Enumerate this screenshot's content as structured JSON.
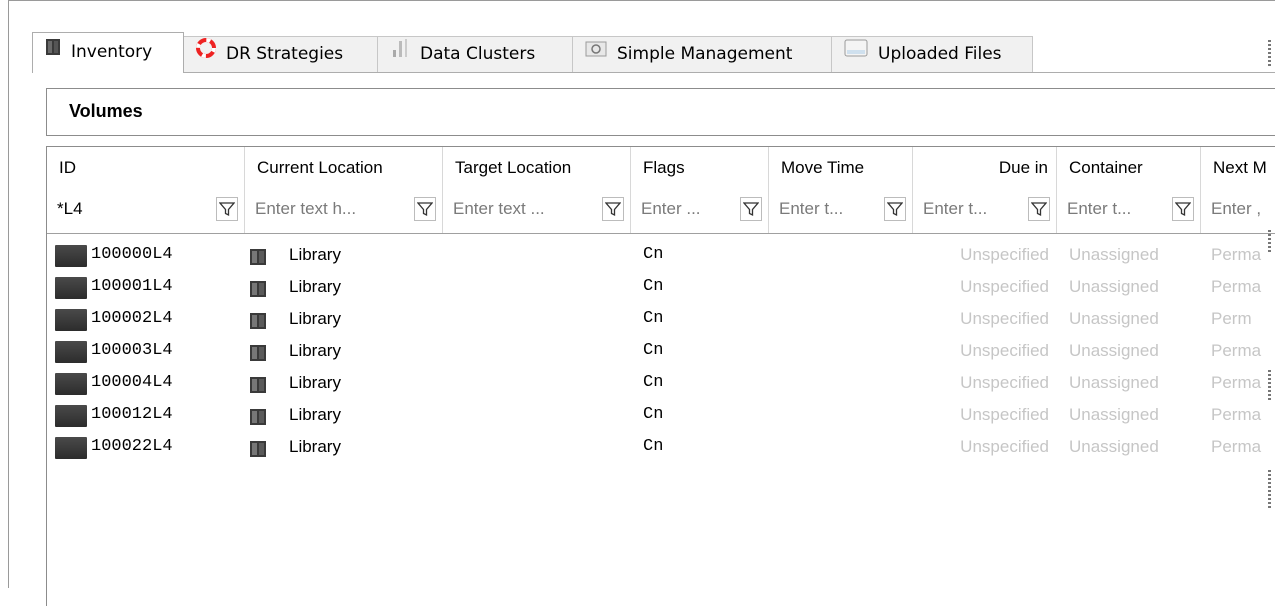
{
  "tabs": [
    {
      "label": "Inventory",
      "icon": "tape-library-icon",
      "active": true
    },
    {
      "label": "DR Strategies",
      "icon": "lifebuoy-icon",
      "active": false
    },
    {
      "label": "Data Clusters",
      "icon": "data-clusters-icon",
      "active": false
    },
    {
      "label": "Simple Management",
      "icon": "simple-management-icon",
      "active": false
    },
    {
      "label": "Uploaded Files",
      "icon": "uploaded-files-icon",
      "active": false
    }
  ],
  "panel": {
    "title": "Volumes"
  },
  "columns": [
    {
      "header": "ID",
      "filter_value": "*L4",
      "filter_placeholder": ""
    },
    {
      "header": "Current Location",
      "filter_value": "",
      "filter_placeholder": "Enter text h..."
    },
    {
      "header": "Target Location",
      "filter_value": "",
      "filter_placeholder": "Enter text ..."
    },
    {
      "header": "Flags",
      "filter_value": "",
      "filter_placeholder": "Enter ..."
    },
    {
      "header": "Move Time",
      "filter_value": "",
      "filter_placeholder": "Enter t..."
    },
    {
      "header": "Due in",
      "filter_value": "",
      "filter_placeholder": "Enter t..."
    },
    {
      "header": "Container",
      "filter_value": "",
      "filter_placeholder": "Enter t..."
    },
    {
      "header": "Next M",
      "filter_value": "",
      "filter_placeholder": "Enter ,"
    }
  ],
  "rows": [
    {
      "id": "100000L4",
      "current_location": "Library",
      "flags": "Cn",
      "due_in": "Unspecified",
      "container": "Unassigned",
      "next": "Perma"
    },
    {
      "id": "100001L4",
      "current_location": "Library",
      "flags": "Cn",
      "due_in": "Unspecified",
      "container": "Unassigned",
      "next": "Perma"
    },
    {
      "id": "100002L4",
      "current_location": "Library",
      "flags": "Cn",
      "due_in": "Unspecified",
      "container": "Unassigned",
      "next": "Perm"
    },
    {
      "id": "100003L4",
      "current_location": "Library",
      "flags": "Cn",
      "due_in": "Unspecified",
      "container": "Unassigned",
      "next": "Perma"
    },
    {
      "id": "100004L4",
      "current_location": "Library",
      "flags": "Cn",
      "due_in": "Unspecified",
      "container": "Unassigned",
      "next": "Perma"
    },
    {
      "id": "100012L4",
      "current_location": "Library",
      "flags": "Cn",
      "due_in": "Unspecified",
      "container": "Unassigned",
      "next": "Perma"
    },
    {
      "id": "100022L4",
      "current_location": "Library",
      "flags": "Cn",
      "due_in": "Unspecified",
      "container": "Unassigned",
      "next": "Perma"
    }
  ],
  "colors": {
    "muted_text": "#c6c6c6",
    "tab_active_bg": "#ffffff",
    "tab_bg": "#f1f1f1",
    "border": "#8c8c8c"
  }
}
